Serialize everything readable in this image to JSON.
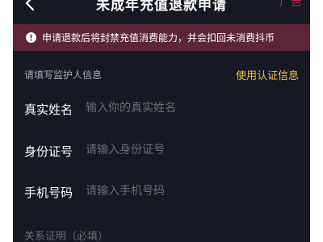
{
  "header": {
    "title": "未成年充值退款申请",
    "right_text": "广告"
  },
  "alert": {
    "text": "申请退款后将封禁充值消费能力，并会扣回未消费抖币"
  },
  "guardian": {
    "section_title": "请填写监护人信息",
    "auth_link": "使用认证信息",
    "fields": [
      {
        "label": "真实姓名",
        "placeholder": "输入你的真实姓名",
        "value": ""
      },
      {
        "label": "身份证号",
        "placeholder": "请输入身份证号",
        "value": ""
      },
      {
        "label": "手机号码",
        "placeholder": "请输入手机号码",
        "value": ""
      }
    ]
  },
  "relationship": {
    "label": "关系证明（必填）"
  },
  "colors": {
    "background": "#161823",
    "alert_bg": "#5c2637",
    "link": "#f7c341",
    "placeholder": "#6c6d75"
  },
  "icons": {
    "back": "chevron-left-icon",
    "alert": "exclamation-circle-icon"
  }
}
